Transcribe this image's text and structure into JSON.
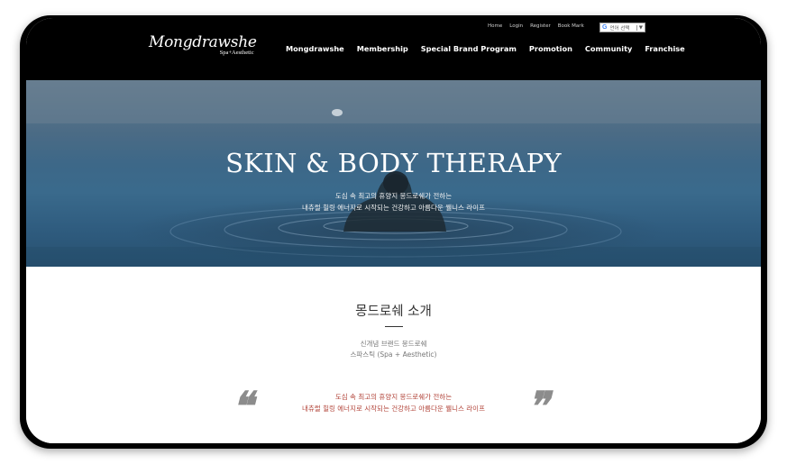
{
  "header": {
    "logo_main": "Mongdrawshe",
    "logo_sub": "Spa+Aesthetic",
    "utility_links": [
      "Home",
      "Login",
      "Register",
      "Book Mark"
    ],
    "translate_label": "언어 선택",
    "nav": [
      "Mongdrawshe",
      "Membership",
      "Special Brand Program",
      "Promotion",
      "Community",
      "Franchise"
    ]
  },
  "hero": {
    "title": "SKIN & BODY THERAPY",
    "line1": "도심 속 최고의 휴양지 몽드로쉐가 전하는",
    "line2": "내츄럴 힐링 에너지로 시작되는 건강하고 아름다운 웰니스 라이프"
  },
  "intro": {
    "title": "몽드로쉐 소개",
    "desc1": "신개념 브랜드 몽드로쉐",
    "desc2": "스파스틱 (Spa + Aesthetic)",
    "quote1": "도심 속 최고의 휴양지 몽드로쉐가 전하는",
    "quote2": "내츄럴 힐링 에너지로 시작되는 건강하고 아름다운 웰니스 라이프"
  },
  "colors": {
    "header_bg": "#000000",
    "quote_text": "#b2443a",
    "hero_water": "#3a6a8c"
  }
}
